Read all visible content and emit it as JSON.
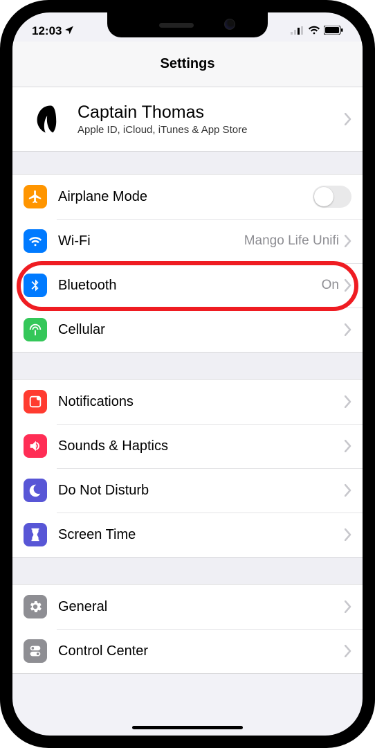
{
  "statusBar": {
    "time": "12:03",
    "locationArrow": "location-arrow-icon"
  },
  "navTitle": "Settings",
  "profile": {
    "name": "Captain Thomas",
    "subtitle": "Apple ID, iCloud, iTunes & App Store"
  },
  "groups": {
    "connectivity": {
      "airplane": {
        "label": "Airplane Mode",
        "iconColor": "#ff9500"
      },
      "wifi": {
        "label": "Wi-Fi",
        "value": "Mango Life Unifi",
        "iconColor": "#007aff"
      },
      "bluetooth": {
        "label": "Bluetooth",
        "value": "On",
        "iconColor": "#007aff"
      },
      "cellular": {
        "label": "Cellular",
        "iconColor": "#34c759"
      }
    },
    "alerts": {
      "notifications": {
        "label": "Notifications",
        "iconColor": "#ff3b30"
      },
      "sounds": {
        "label": "Sounds & Haptics",
        "iconColor": "#ff2d55"
      },
      "dnd": {
        "label": "Do Not Disturb",
        "iconColor": "#5856d6"
      },
      "screentime": {
        "label": "Screen Time",
        "iconColor": "#5856d6"
      }
    },
    "system": {
      "general": {
        "label": "General",
        "iconColor": "#8e8e93"
      },
      "controlcenter": {
        "label": "Control Center",
        "iconColor": "#8e8e93"
      }
    }
  },
  "highlight": "bluetooth"
}
